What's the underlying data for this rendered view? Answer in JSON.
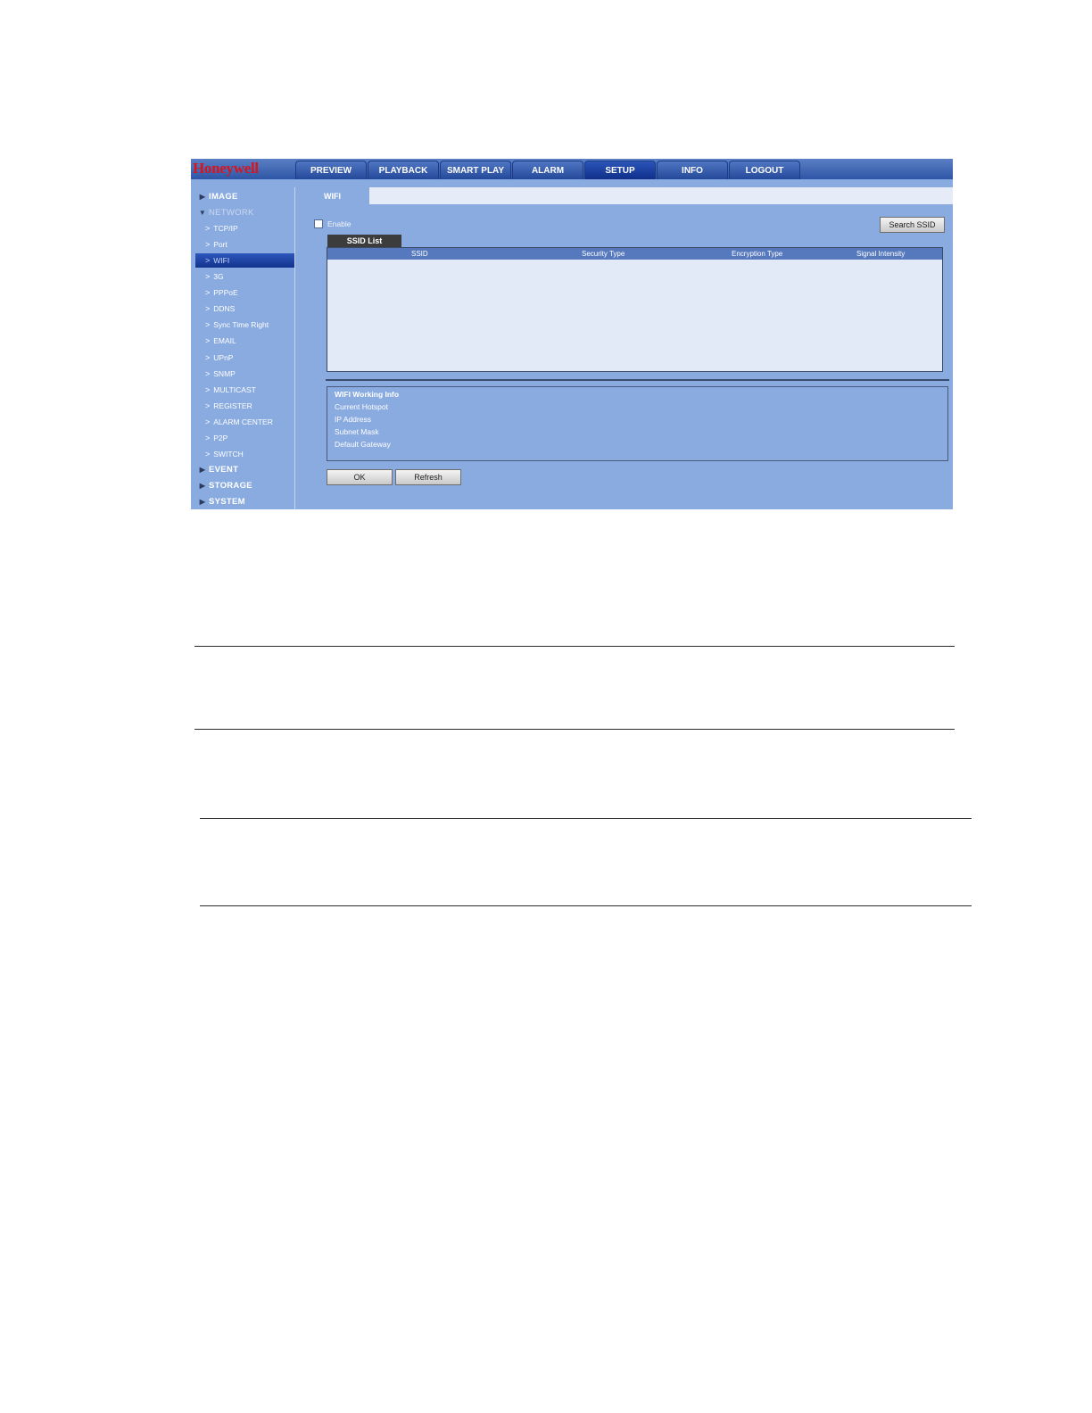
{
  "brand": {
    "logo": "Honeywell",
    "logo_color": "#d8141c"
  },
  "nav": {
    "tabs": [
      {
        "label": "PREVIEW"
      },
      {
        "label": "PLAYBACK"
      },
      {
        "label": "SMART PLAY"
      },
      {
        "label": "ALARM"
      },
      {
        "label": "SETUP",
        "active": true
      },
      {
        "label": "INFO"
      },
      {
        "label": "LOGOUT"
      }
    ]
  },
  "sidebar": {
    "items": [
      {
        "label": "IMAGE",
        "kind": "section",
        "icon": "triangle-right-icon"
      },
      {
        "label": "NETWORK",
        "kind": "section-dim",
        "icon": "triangle-down-icon"
      },
      {
        "label": "TCP/IP",
        "kind": "sub",
        "icon": "chevron-right-icon"
      },
      {
        "label": "Port",
        "kind": "sub",
        "icon": "chevron-right-icon"
      },
      {
        "label": "WIFI",
        "kind": "sub-active",
        "icon": "chevron-right-icon"
      },
      {
        "label": "3G",
        "kind": "sub",
        "icon": "chevron-right-icon"
      },
      {
        "label": "PPPoE",
        "kind": "sub",
        "icon": "chevron-right-icon"
      },
      {
        "label": "DDNS",
        "kind": "sub",
        "icon": "chevron-right-icon"
      },
      {
        "label": "Sync Time Right",
        "kind": "sub",
        "icon": "chevron-right-icon"
      },
      {
        "label": "EMAIL",
        "kind": "sub",
        "icon": "chevron-right-icon"
      },
      {
        "label": "UPnP",
        "kind": "sub",
        "icon": "chevron-right-icon"
      },
      {
        "label": "SNMP",
        "kind": "sub",
        "icon": "chevron-right-icon"
      },
      {
        "label": "MULTICAST",
        "kind": "sub",
        "icon": "chevron-right-icon"
      },
      {
        "label": "REGISTER",
        "kind": "sub",
        "icon": "chevron-right-icon"
      },
      {
        "label": "ALARM CENTER",
        "kind": "sub",
        "icon": "chevron-right-icon"
      },
      {
        "label": "P2P",
        "kind": "sub",
        "icon": "chevron-right-icon"
      },
      {
        "label": "SWITCH",
        "kind": "sub",
        "icon": "chevron-right-icon"
      },
      {
        "label": "EVENT",
        "kind": "section",
        "icon": "triangle-right-icon"
      },
      {
        "label": "STORAGE",
        "kind": "section",
        "icon": "triangle-right-icon"
      },
      {
        "label": "SYSTEM",
        "kind": "section",
        "icon": "triangle-right-icon"
      }
    ]
  },
  "page": {
    "tab_label": "WIFI",
    "enable_label": "Enable",
    "enable_checked": false,
    "search_button": "Search SSID",
    "ssid_list_tab": "SSID List",
    "ssid_columns": [
      "SSID",
      "Security Type",
      "Encryption Type",
      "Signal Intensity"
    ],
    "ssid_rows": [],
    "info": {
      "title": "WIFI Working Info",
      "lines": [
        "Current Hotspot",
        "IP Address",
        "Subnet Mask",
        "Default Gateway"
      ]
    },
    "ok_button": "OK",
    "refresh_button": "Refresh"
  }
}
